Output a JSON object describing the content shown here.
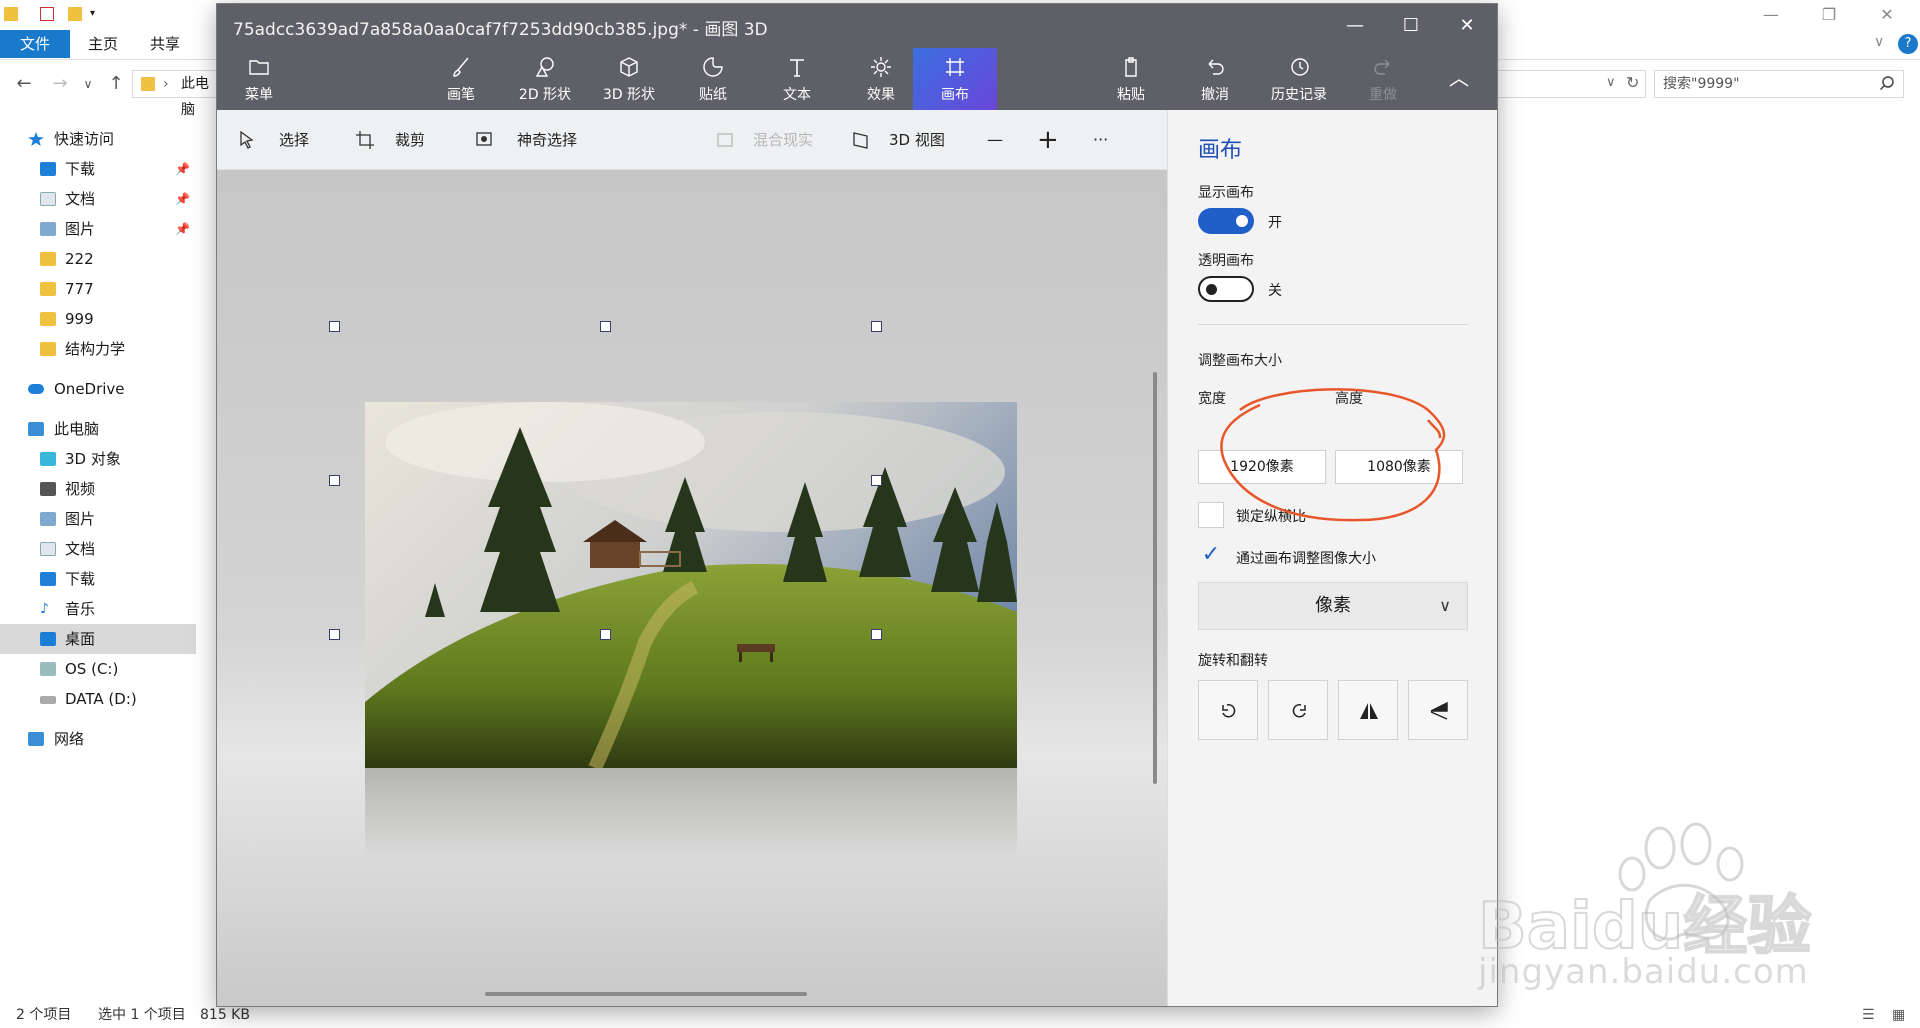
{
  "explorer": {
    "ribbon_tabs": [
      "文件",
      "主页",
      "共享"
    ],
    "address_text": "此电脑",
    "search_placeholder": "搜索\"9999\"",
    "sidebar": {
      "quick_access": "快速访问",
      "pinned": [
        "下载",
        "文档",
        "图片"
      ],
      "folders": [
        "222",
        "777",
        "999",
        "结构力学"
      ],
      "onedrive": "OneDrive",
      "this_pc": "此电脑",
      "pc_items": [
        "3D 对象",
        "视频",
        "图片",
        "文档",
        "下载",
        "音乐",
        "桌面",
        "OS (C:)",
        "DATA (D:)"
      ],
      "network": "网络"
    },
    "status": {
      "count": "2 个项目",
      "selected": "选中 1 个项目",
      "size": "815 KB"
    }
  },
  "paint3d": {
    "title": "75adcc3639ad7a858a0aa0caf7f7253dd90cb385.jpg* - 画图 3D",
    "toolbar": {
      "menu": "菜单",
      "brushes": "画笔",
      "shapes2d": "2D 形状",
      "shapes3d": "3D 形状",
      "stickers": "贴纸",
      "text": "文本",
      "effects": "效果",
      "canvas": "画布",
      "paste": "粘贴",
      "undo": "撤消",
      "history": "历史记录",
      "redo": "重做"
    },
    "subbar": {
      "select": "选择",
      "crop": "裁剪",
      "magic_select": "神奇选择",
      "mixed_reality": "混合现实",
      "view3d": "3D 视图",
      "zoom_out": "—",
      "zoom_in": "+",
      "more": "···"
    },
    "panel": {
      "title": "画布",
      "show_canvas": "显示画布",
      "show_canvas_state": "开",
      "transparent_canvas": "透明画布",
      "transparent_state": "关",
      "resize_title": "调整画布大小",
      "width_label": "宽度",
      "height_label": "高度",
      "width_value": "1920像素",
      "height_value": "1080像素",
      "lock_aspect": "锁定纵横比",
      "resize_image": "通过画布调整图像大小",
      "unit": "像素",
      "rotate_flip": "旋转和翻转"
    },
    "accent": "#1f5fc7",
    "annotation_color": "#e8572a"
  },
  "watermark": {
    "brand": "Baidu经验",
    "url": "jingyan.baidu.com"
  }
}
